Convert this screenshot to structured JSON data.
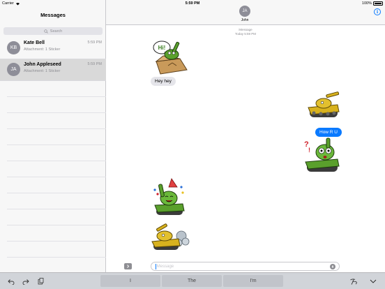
{
  "status_bar": {
    "carrier": "Carrier",
    "time": "5:59 PM",
    "battery": "100%"
  },
  "sidebar": {
    "title": "Messages",
    "search_placeholder": "Search",
    "conversations": [
      {
        "initials": "KB",
        "name": "Kate Bell",
        "preview": "Attachment: 1 Sticker",
        "time": "5:59 PM",
        "selected": false
      },
      {
        "initials": "JA",
        "name": "John Appleseed",
        "preview": "Attachment: 1 Sticker",
        "time": "5:59 PM",
        "selected": true
      }
    ]
  },
  "chat": {
    "contact_initials": "JA",
    "contact_name": "John",
    "service_label": "iMessage",
    "service_time": "Today 5:59 PM",
    "messages": [
      {
        "kind": "sticker",
        "direction": "incoming",
        "icon": "tank-sticker-green-box",
        "speech": "Hi!"
      },
      {
        "kind": "text",
        "direction": "incoming",
        "text": "Hey hey"
      },
      {
        "kind": "sticker",
        "direction": "outgoing",
        "icon": "tank-sticker-yellow"
      },
      {
        "kind": "text",
        "direction": "outgoing",
        "text": "How R U"
      },
      {
        "kind": "sticker",
        "direction": "outgoing",
        "icon": "tank-sticker-green-surprised"
      },
      {
        "kind": "sticker",
        "direction": "incoming",
        "icon": "tank-sticker-green-party"
      },
      {
        "kind": "sticker",
        "direction": "incoming",
        "icon": "tank-sticker-yellow-smoke"
      }
    ],
    "compose_placeholder": "Message"
  },
  "keyboard": {
    "suggestions": [
      "I",
      "The",
      "I'm"
    ]
  },
  "colors": {
    "accent": "#0a7aff",
    "incoming_bubble": "#e5e5ea",
    "tank_green": "#5aa02c",
    "tank_yellow": "#d8b21e"
  }
}
